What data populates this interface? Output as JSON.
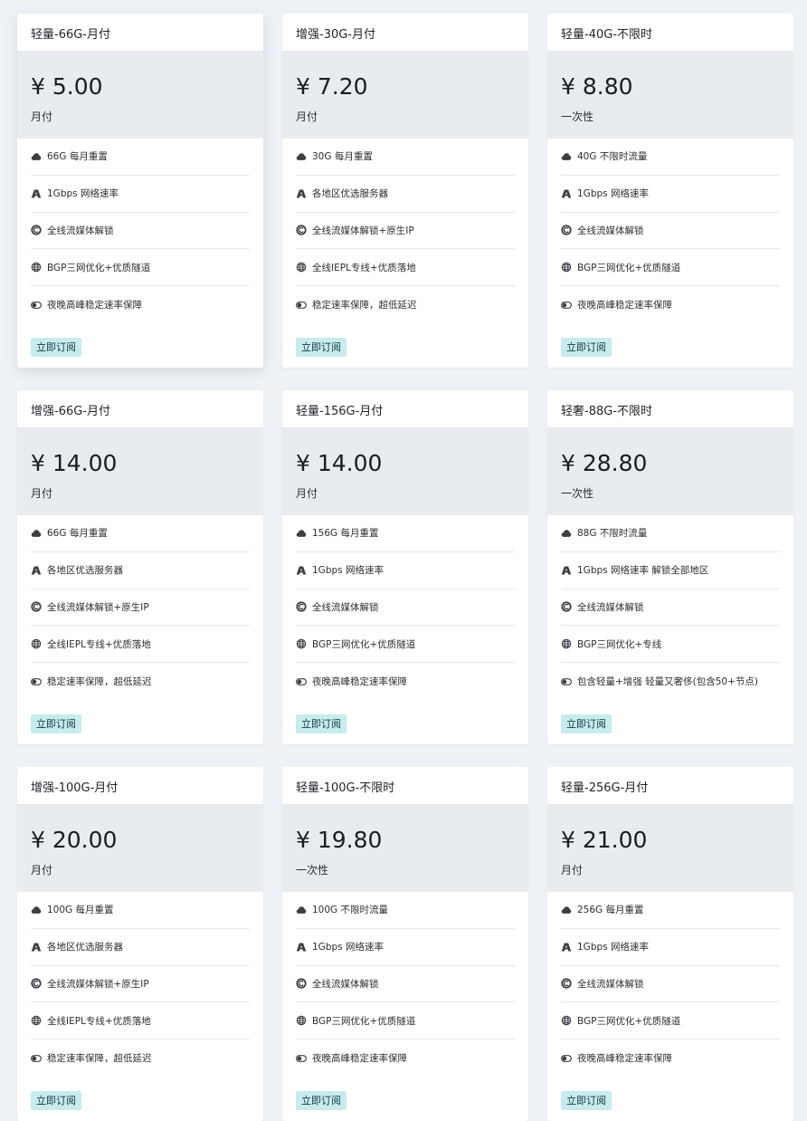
{
  "buy_label": "立即订阅",
  "colors": {
    "page_bg": "#eef1f6",
    "price_band": "#e9ecef",
    "button_bg": "#c8ebed"
  },
  "icons": [
    "cloud-icon",
    "speed-icon",
    "unlock-icon",
    "globe-icon",
    "toggle-icon"
  ],
  "plans": [
    {
      "title": "轻量-66G-月付",
      "price": "¥ 5.00",
      "period": "月付",
      "features": [
        "66G 每月重置",
        "1Gbps 网络速率",
        "全线流媒体解锁",
        "BGP三网优化+优质隧道",
        "夜晚高峰稳定速率保障"
      ]
    },
    {
      "title": "增强-30G-月付",
      "price": "¥ 7.20",
      "period": "月付",
      "features": [
        "30G 每月重置",
        "各地区优选服务器",
        "全线流媒体解锁+原生IP",
        "全线IEPL专线+优质落地",
        "稳定速率保障，超低延迟"
      ]
    },
    {
      "title": "轻量-40G-不限时",
      "price": "¥ 8.80",
      "period": "一次性",
      "features": [
        "40G 不限时流量",
        "1Gbps 网络速率",
        "全线流媒体解锁",
        "BGP三网优化+优质隧道",
        "夜晚高峰稳定速率保障"
      ]
    },
    {
      "title": "增强-66G-月付",
      "price": "¥ 14.00",
      "period": "月付",
      "features": [
        "66G 每月重置",
        "各地区优选服务器",
        "全线流媒体解锁+原生IP",
        "全线IEPL专线+优质落地",
        "稳定速率保障，超低延迟"
      ]
    },
    {
      "title": "轻量-156G-月付",
      "price": "¥ 14.00",
      "period": "月付",
      "features": [
        "156G 每月重置",
        "1Gbps 网络速率",
        "全线流媒体解锁",
        "BGP三网优化+优质隧道",
        "夜晚高峰稳定速率保障"
      ]
    },
    {
      "title": "轻奢-88G-不限时",
      "price": "¥ 28.80",
      "period": "一次性",
      "features": [
        "88G 不限时流量",
        "1Gbps 网络速率 解锁全部地区",
        "全线流媒体解锁",
        "BGP三网优化+专线",
        "包含轻量+增强 轻量又奢侈(包含50+节点)"
      ]
    },
    {
      "title": "增强-100G-月付",
      "price": "¥ 20.00",
      "period": "月付",
      "features": [
        "100G 每月重置",
        "各地区优选服务器",
        "全线流媒体解锁+原生IP",
        "全线IEPL专线+优质落地",
        "稳定速率保障，超低延迟"
      ]
    },
    {
      "title": "轻量-100G-不限时",
      "price": "¥ 19.80",
      "period": "一次性",
      "features": [
        "100G 不限时流量",
        "1Gbps 网络速率",
        "全线流媒体解锁",
        "BGP三网优化+优质隧道",
        "夜晚高峰稳定速率保障"
      ]
    },
    {
      "title": "轻量-256G-月付",
      "price": "¥ 21.00",
      "period": "月付",
      "features": [
        "256G 每月重置",
        "1Gbps 网络速率",
        "全线流媒体解锁",
        "BGP三网优化+优质隧道",
        "夜晚高峰稳定速率保障"
      ]
    }
  ]
}
